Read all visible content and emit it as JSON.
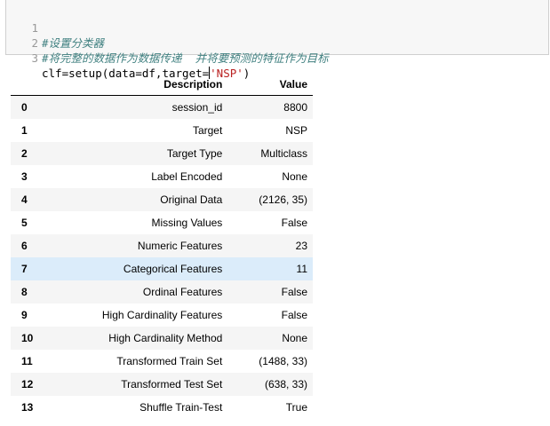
{
  "code_cell": {
    "lines": [
      {
        "number": "1",
        "text": "#设置分类器"
      },
      {
        "number": "2",
        "text": "#将完整的数据作为数据传递  并将要预测的特征作为目标"
      },
      {
        "number": "3",
        "prefix": "clf=setup(data=df,target=",
        "string": "'NSP'",
        "suffix": ")"
      }
    ]
  },
  "table": {
    "headers": {
      "index": "",
      "description": "Description",
      "value": "Value"
    },
    "rows": [
      {
        "index": "0",
        "description": "session_id",
        "value": "8800"
      },
      {
        "index": "1",
        "description": "Target",
        "value": "NSP"
      },
      {
        "index": "2",
        "description": "Target Type",
        "value": "Multiclass"
      },
      {
        "index": "3",
        "description": "Label Encoded",
        "value": "None"
      },
      {
        "index": "4",
        "description": "Original Data",
        "value": "(2126, 35)"
      },
      {
        "index": "5",
        "description": "Missing Values",
        "value": "False"
      },
      {
        "index": "6",
        "description": "Numeric Features",
        "value": "23"
      },
      {
        "index": "7",
        "description": "Categorical Features",
        "value": "11"
      },
      {
        "index": "8",
        "description": "Ordinal Features",
        "value": "False"
      },
      {
        "index": "9",
        "description": "High Cardinality Features",
        "value": "False"
      },
      {
        "index": "10",
        "description": "High Cardinality Method",
        "value": "None"
      },
      {
        "index": "11",
        "description": "Transformed Train Set",
        "value": "(1488, 33)"
      },
      {
        "index": "12",
        "description": "Transformed Test Set",
        "value": "(638, 33)"
      },
      {
        "index": "13",
        "description": "Shuffle Train-Test",
        "value": "True"
      }
    ],
    "highlighted_row": "7"
  },
  "colors": {
    "comment": "#408080",
    "string": "#ba2121",
    "row_stripe": "#f5f5f5",
    "row_highlight": "#dbecfa"
  }
}
